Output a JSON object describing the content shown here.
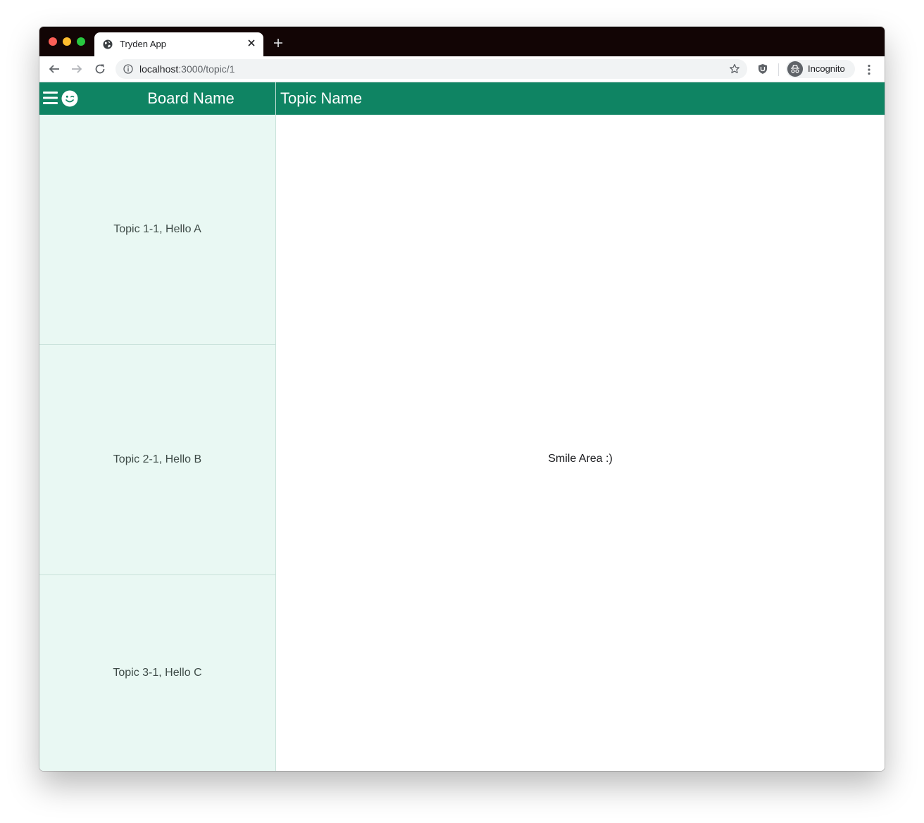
{
  "browser": {
    "tab_title": "Tryden App",
    "url_host": "localhost",
    "url_path": ":3000/topic/1",
    "incognito_label": "Incognito"
  },
  "app": {
    "board_name": "Board Name",
    "topic_name": "Topic Name",
    "topics": [
      {
        "label": "Topic 1-1, Hello A"
      },
      {
        "label": "Topic 2-1, Hello B"
      },
      {
        "label": "Topic 3-1, Hello C"
      }
    ],
    "smile_area": "Smile Area :)",
    "accent_color": "#0f8463",
    "sidebar_bg": "#e9f8f3"
  }
}
